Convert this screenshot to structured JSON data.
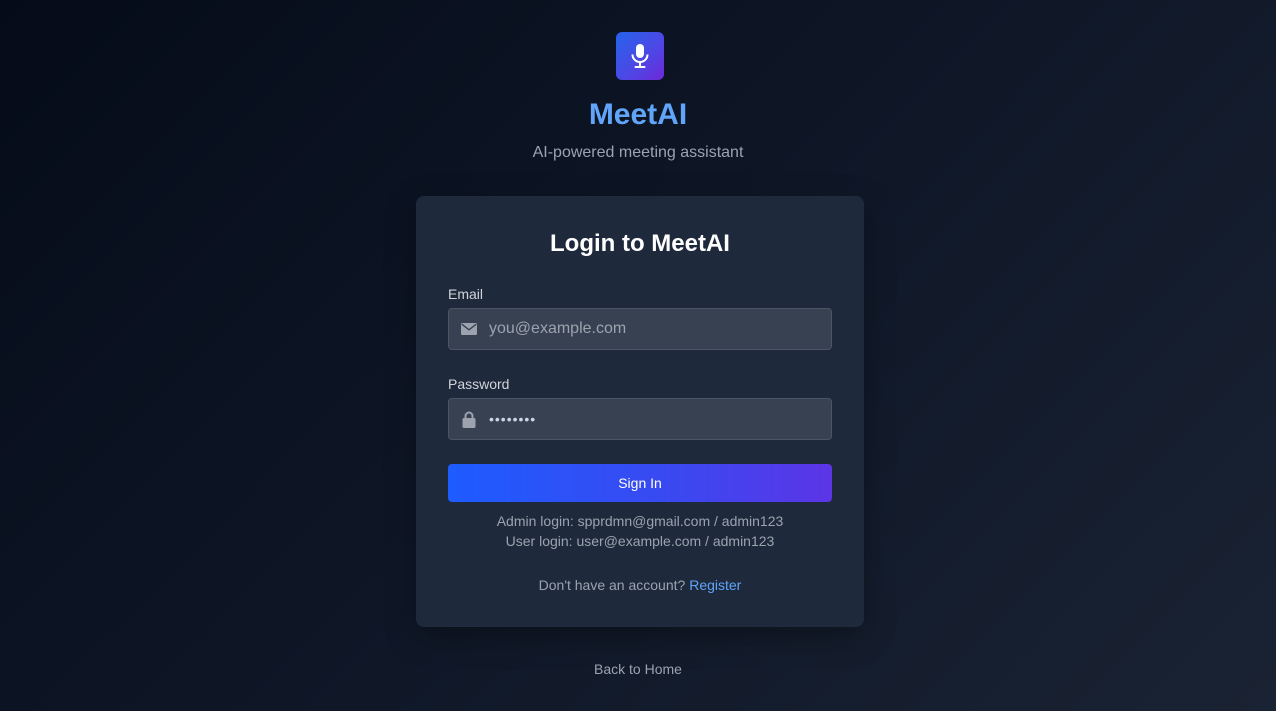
{
  "brand": {
    "title": "MeetAI",
    "subtitle": "AI-powered meeting assistant",
    "logo_icon": "microphone-icon"
  },
  "login_card": {
    "title": "Login to MeetAI",
    "email": {
      "label": "Email",
      "placeholder": "you@example.com",
      "value": "",
      "icon": "envelope-icon"
    },
    "password": {
      "label": "Password",
      "value": "••••••••",
      "icon": "lock-icon"
    },
    "sign_in_label": "Sign In",
    "admin_hint": "Admin login: spprdmn@gmail.com / admin123",
    "user_hint": "User login: user@example.com / admin123",
    "register_prompt": "Don't have an account?",
    "register_link": "Register"
  },
  "footer": {
    "back_home": "Back to Home"
  },
  "colors": {
    "accent": "#60a5fa",
    "button_start": "#1d5cff",
    "button_end": "#5b35e6",
    "card_bg": "#1e293b",
    "input_bg": "#374151"
  }
}
